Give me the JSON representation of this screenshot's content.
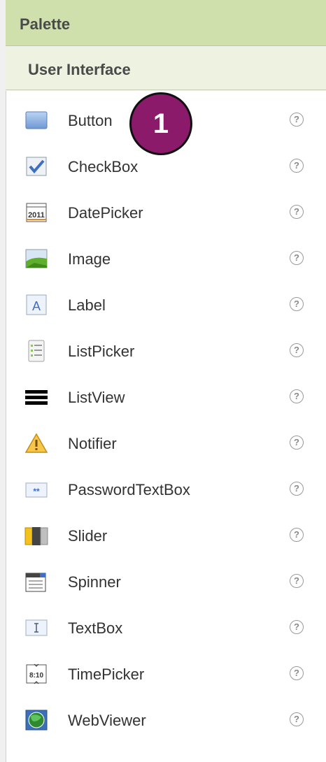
{
  "palette": {
    "title": "Palette"
  },
  "section": {
    "title": "User Interface"
  },
  "items": [
    {
      "label": "Button",
      "icon": "button-icon"
    },
    {
      "label": "CheckBox",
      "icon": "checkbox-icon"
    },
    {
      "label": "DatePicker",
      "icon": "calendar-icon",
      "icon_text": "2011"
    },
    {
      "label": "Image",
      "icon": "image-icon"
    },
    {
      "label": "Label",
      "icon": "label-icon",
      "icon_text": "A"
    },
    {
      "label": "ListPicker",
      "icon": "list-picker-icon"
    },
    {
      "label": "ListView",
      "icon": "list-view-icon"
    },
    {
      "label": "Notifier",
      "icon": "warning-icon"
    },
    {
      "label": "PasswordTextBox",
      "icon": "password-icon",
      "icon_text": "**"
    },
    {
      "label": "Slider",
      "icon": "slider-icon"
    },
    {
      "label": "Spinner",
      "icon": "spinner-icon"
    },
    {
      "label": "TextBox",
      "icon": "textbox-icon"
    },
    {
      "label": "TimePicker",
      "icon": "clock-icon",
      "icon_text": "8:10"
    },
    {
      "label": "WebViewer",
      "icon": "globe-icon"
    }
  ],
  "help_glyph": "?",
  "badge": {
    "text": "1",
    "color": "#8b1a6b"
  },
  "colors": {
    "header_bg": "#cfe0ad",
    "section_bg": "#eef3e1"
  }
}
